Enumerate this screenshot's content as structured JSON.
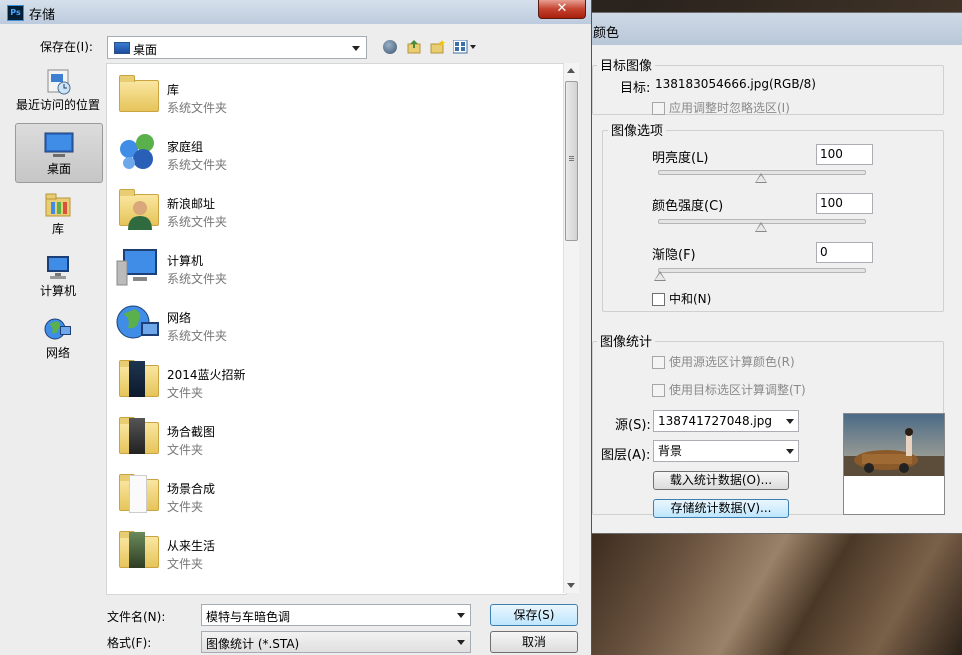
{
  "save_dialog": {
    "title": "存储",
    "ps_icon": "Ps",
    "close_glyph": "✕",
    "save_in_label": "保存在(I):",
    "location": "桌面",
    "places": [
      {
        "label": "最近访问的位置",
        "icon": "recent-places-icon"
      },
      {
        "label": "桌面",
        "icon": "desktop-icon"
      },
      {
        "label": "库",
        "icon": "libraries-icon"
      },
      {
        "label": "计算机",
        "icon": "computer-icon"
      },
      {
        "label": "网络",
        "icon": "network-icon"
      }
    ],
    "files": [
      {
        "name": "库",
        "type": "系统文件夹",
        "icon": "libraries-folder-icon"
      },
      {
        "name": "家庭组",
        "type": "系统文件夹",
        "icon": "homegroup-icon"
      },
      {
        "name": "新浪邮址",
        "type": "系统文件夹",
        "icon": "user-folder-icon"
      },
      {
        "name": "计算机",
        "type": "系统文件夹",
        "icon": "computer-icon"
      },
      {
        "name": "网络",
        "type": "系统文件夹",
        "icon": "network-icon"
      },
      {
        "name": "2014蓝火招新",
        "type": "文件夹",
        "icon": "folder-icon"
      },
      {
        "name": "场合截图",
        "type": "文件夹",
        "icon": "folder-icon"
      },
      {
        "name": "场景合成",
        "type": "文件夹",
        "icon": "folder-icon"
      },
      {
        "name": "从来生活",
        "type": "文件夹",
        "icon": "folder-icon"
      }
    ],
    "filename_label": "文件名(N):",
    "filename_value": "模特与车暗色调",
    "format_label": "格式(F):",
    "format_value": "图像统计 (*.STA)",
    "save_button": "保存(S)",
    "cancel_button": "取消"
  },
  "match_color": {
    "title": "颜色",
    "target_group": "目标图像",
    "target_label": "目标:",
    "target_value": "138183054666.jpg(RGB/8)",
    "ignore_selection": "应用调整时忽略选区(I)",
    "options_group": "图像选项",
    "luminance_label": "明亮度(L)",
    "luminance_value": "100",
    "luminance_level": 0.5,
    "color_intensity_label": "颜色强度(C)",
    "color_intensity_value": "100",
    "color_intensity_level": 0.5,
    "fade_label": "渐隐(F)",
    "fade_value": "0",
    "fade_level": 0.0,
    "neutralize_label": "中和(N)",
    "stats_group": "图像统计",
    "use_source_selection": "使用源选区计算颜色(R)",
    "use_target_selection": "使用目标选区计算调整(T)",
    "source_label": "源(S):",
    "source_value": "138741727048.jpg",
    "layer_label": "图层(A):",
    "layer_value": "背景",
    "load_stats_button": "载入统计数据(O)...",
    "save_stats_button": "存储统计数据(V)..."
  }
}
